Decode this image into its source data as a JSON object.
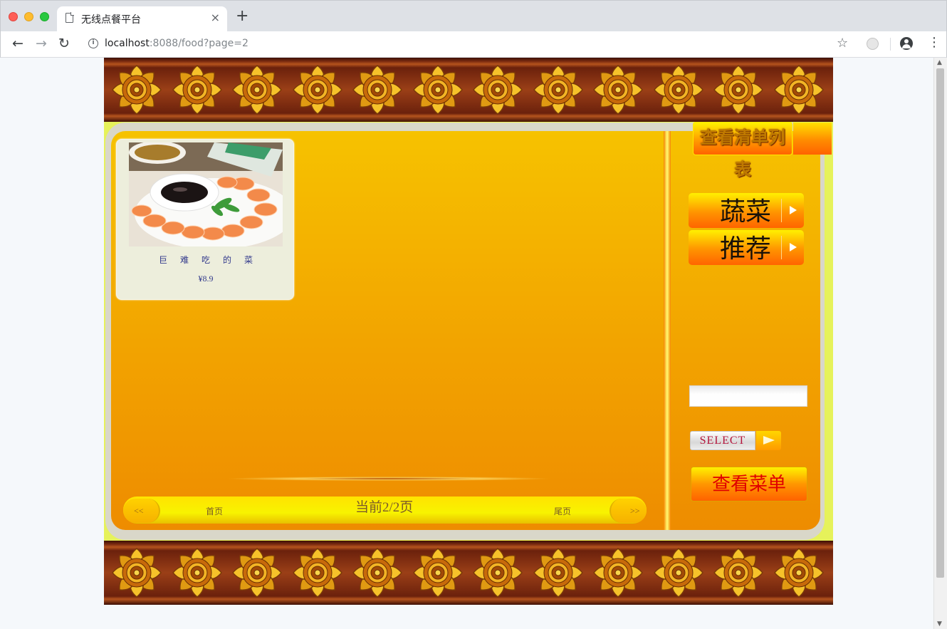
{
  "browser": {
    "tab_title": "无线点餐平台",
    "tab_close": "×",
    "new_tab": "+",
    "url_host": "localhost",
    "url_rest": ":8088/food?page=2",
    "back": "←",
    "forward": "→",
    "reload": "↻",
    "info": "i",
    "bookmark": "☆",
    "menu": "⋮"
  },
  "header": {
    "view_list_label": "查看清单列表"
  },
  "food_items": [
    {
      "name": "巨难吃的菜",
      "price": "¥8.9"
    }
  ],
  "categories": [
    {
      "label": "蔬菜"
    },
    {
      "label": "推荐"
    }
  ],
  "search": {
    "value": "",
    "button_label": "SELECT"
  },
  "view_menu_label": "查看菜单",
  "pagination": {
    "prev": "<<",
    "first": "首页",
    "current": "当前2/2页",
    "last": "尾页",
    "next": ">>"
  },
  "colors": {
    "panel_orange": "#f2a300",
    "wood_border": "#7a2a10",
    "menu_text_red": "#e00000",
    "food_text_blue": "#333a8c"
  }
}
